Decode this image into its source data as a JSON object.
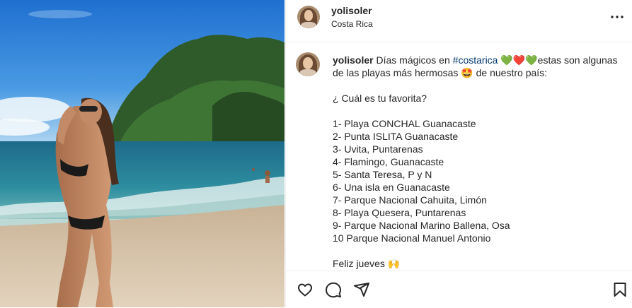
{
  "post": {
    "username": "yolisoler",
    "location": "Costa Rica",
    "caption_line1": "Días mágicos en ",
    "hashtag": "#costarica",
    "emoji_hearts": "💚❤️💚",
    "caption_line1_cont": "estas son algunas de las playas más hermosas ",
    "emoji_star_eyes": "🤩",
    "caption_line1_end": " de nuestro país:",
    "question": "¿ Cuál es tu favorita?",
    "list": [
      "1- Playa CONCHAL Guanacaste",
      "2- Punta ISLITA Guanacaste",
      "3- Uvita, Puntarenas",
      "4- Flamingo, Guanacaste",
      "5- Santa Teresa, P y N",
      "6- Una isla en Guanacaste",
      "7- Parque Nacional Cahuita, Limón",
      "8- Playa Quesera, Puntarenas",
      "9- Parque Nacional Marino Ballena, Osa",
      "10 Parque Nacional Manuel Antonio"
    ],
    "closing": "Feliz jueves 🙌"
  },
  "icons": {
    "more": "more-options-icon",
    "like": "heart-icon",
    "comment": "comment-icon",
    "share": "share-icon",
    "save": "bookmark-icon"
  },
  "colors": {
    "hashtag": "#00376b",
    "text": "#262626",
    "divider": "#efefef"
  }
}
